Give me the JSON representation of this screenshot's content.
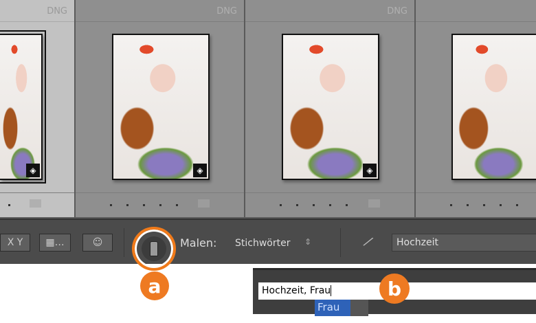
{
  "grid": {
    "cells": [
      {
        "format": "DNG",
        "selected": true
      },
      {
        "format": "DNG",
        "selected": false
      },
      {
        "format": "DNG",
        "selected": false
      },
      {
        "format": "",
        "selected": false
      }
    ]
  },
  "toolbar": {
    "sort_xy_label": "X Y",
    "painter_label": "Malen:",
    "paint_target": "Stichwörter",
    "keyword_value": "Hochzeit"
  },
  "callouts": {
    "a": "a",
    "b": "b"
  },
  "keyword_popup": {
    "input_value": "Hochzeit, Frau",
    "suggestion": "Frau"
  },
  "colors": {
    "accent": "#ee7a22",
    "highlight": "#2e62b8"
  }
}
